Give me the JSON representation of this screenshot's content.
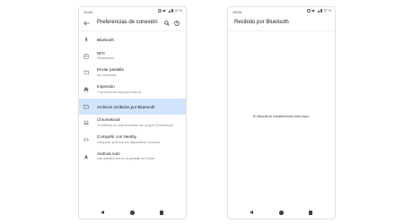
{
  "left_screen": {
    "status_bar": {
      "time": "13:04",
      "battery": "37 %"
    },
    "title": "Preferencias de conexión",
    "icons": {
      "back": "arrow-back-icon",
      "search": "search-icon",
      "help": "help-icon"
    },
    "items": [
      {
        "icon": "bluetooth-icon",
        "title": "Bluetooth",
        "subtitle": ""
      },
      {
        "icon": "nfc-icon",
        "title": "NFC",
        "subtitle": "Desactivado"
      },
      {
        "icon": "cast-icon",
        "title": "Enviar pantalla",
        "subtitle": "No conectado"
      },
      {
        "icon": "print-icon",
        "title": "Impresión",
        "subtitle": "2 servicios de impresión activos"
      },
      {
        "icon": "folder-icon",
        "title": "Archivos recibidos por Bluetooth",
        "subtitle": ""
      },
      {
        "icon": "chromebook-icon",
        "title": "Chromebook",
        "subtitle": "Tu teléfono no está vinculado con ningún Chromebook"
      },
      {
        "icon": "nearby-share-icon",
        "title": "Compartir con Nearby",
        "subtitle": "Comparte archivos con dispositivos cercanos"
      },
      {
        "icon": "android-auto-icon",
        "title": "Android Auto",
        "subtitle": "Usa aplicaciones en la pantalla del coche"
      }
    ],
    "selected_index": 4
  },
  "right_screen": {
    "status_bar": {
      "time": "13:04",
      "battery": "37 %"
    },
    "title": "Recibido por Bluetooth",
    "empty_message": "El historial de transferencias está vacío."
  },
  "colors": {
    "selected_item_bg": "#d2e3fc",
    "icon": "#5f6368"
  }
}
